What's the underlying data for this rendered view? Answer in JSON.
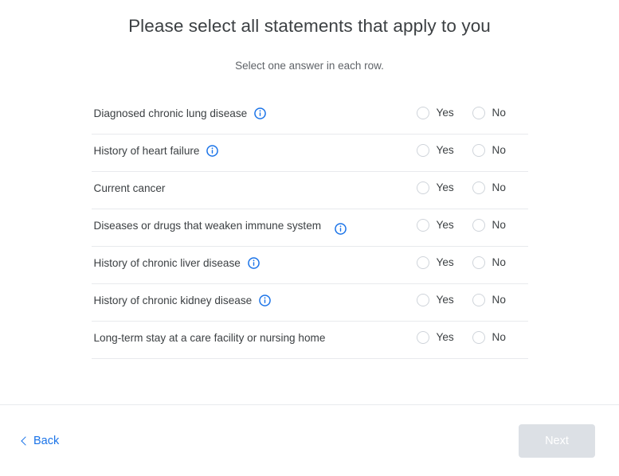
{
  "page": {
    "title": "Please select all statements that apply to you",
    "subtitle": "Select one answer in each row."
  },
  "matrix": {
    "options": [
      {
        "label": "Yes",
        "value": "yes"
      },
      {
        "label": "No",
        "value": "no"
      }
    ],
    "rows": [
      {
        "label": "Diagnosed chronic lung disease",
        "has_info": true,
        "icon": "info-icon",
        "wraps": false,
        "selected": null
      },
      {
        "label": "History of heart failure",
        "has_info": true,
        "icon": "info-icon",
        "wraps": false,
        "selected": null
      },
      {
        "label": "Current cancer",
        "has_info": false,
        "icon": null,
        "wraps": false,
        "selected": null
      },
      {
        "label": "Diseases or drugs that weaken immune system",
        "has_info": true,
        "icon": "info-icon",
        "wraps": true,
        "selected": null
      },
      {
        "label": "History of chronic liver disease",
        "has_info": true,
        "icon": "info-icon",
        "wraps": false,
        "selected": null
      },
      {
        "label": "History of chronic kidney disease",
        "has_info": true,
        "icon": "info-icon",
        "wraps": false,
        "selected": null
      },
      {
        "label": "Long-term stay at a care facility or nursing home",
        "has_info": false,
        "icon": null,
        "wraps": true,
        "selected": null
      }
    ]
  },
  "footer": {
    "back_label": "Back",
    "back_icon": "chevron-left-icon",
    "next_label": "Next",
    "next_disabled": true
  },
  "colors": {
    "link_blue": "#1a73e8",
    "info_blue": "#1a73e8",
    "text_primary": "#3c4043",
    "text_secondary": "#5f6368",
    "divider": "#e8eaed",
    "radio_border": "#cfd4da",
    "next_disabled_bg": "#dce0e5",
    "next_disabled_text": "#ffffff"
  }
}
